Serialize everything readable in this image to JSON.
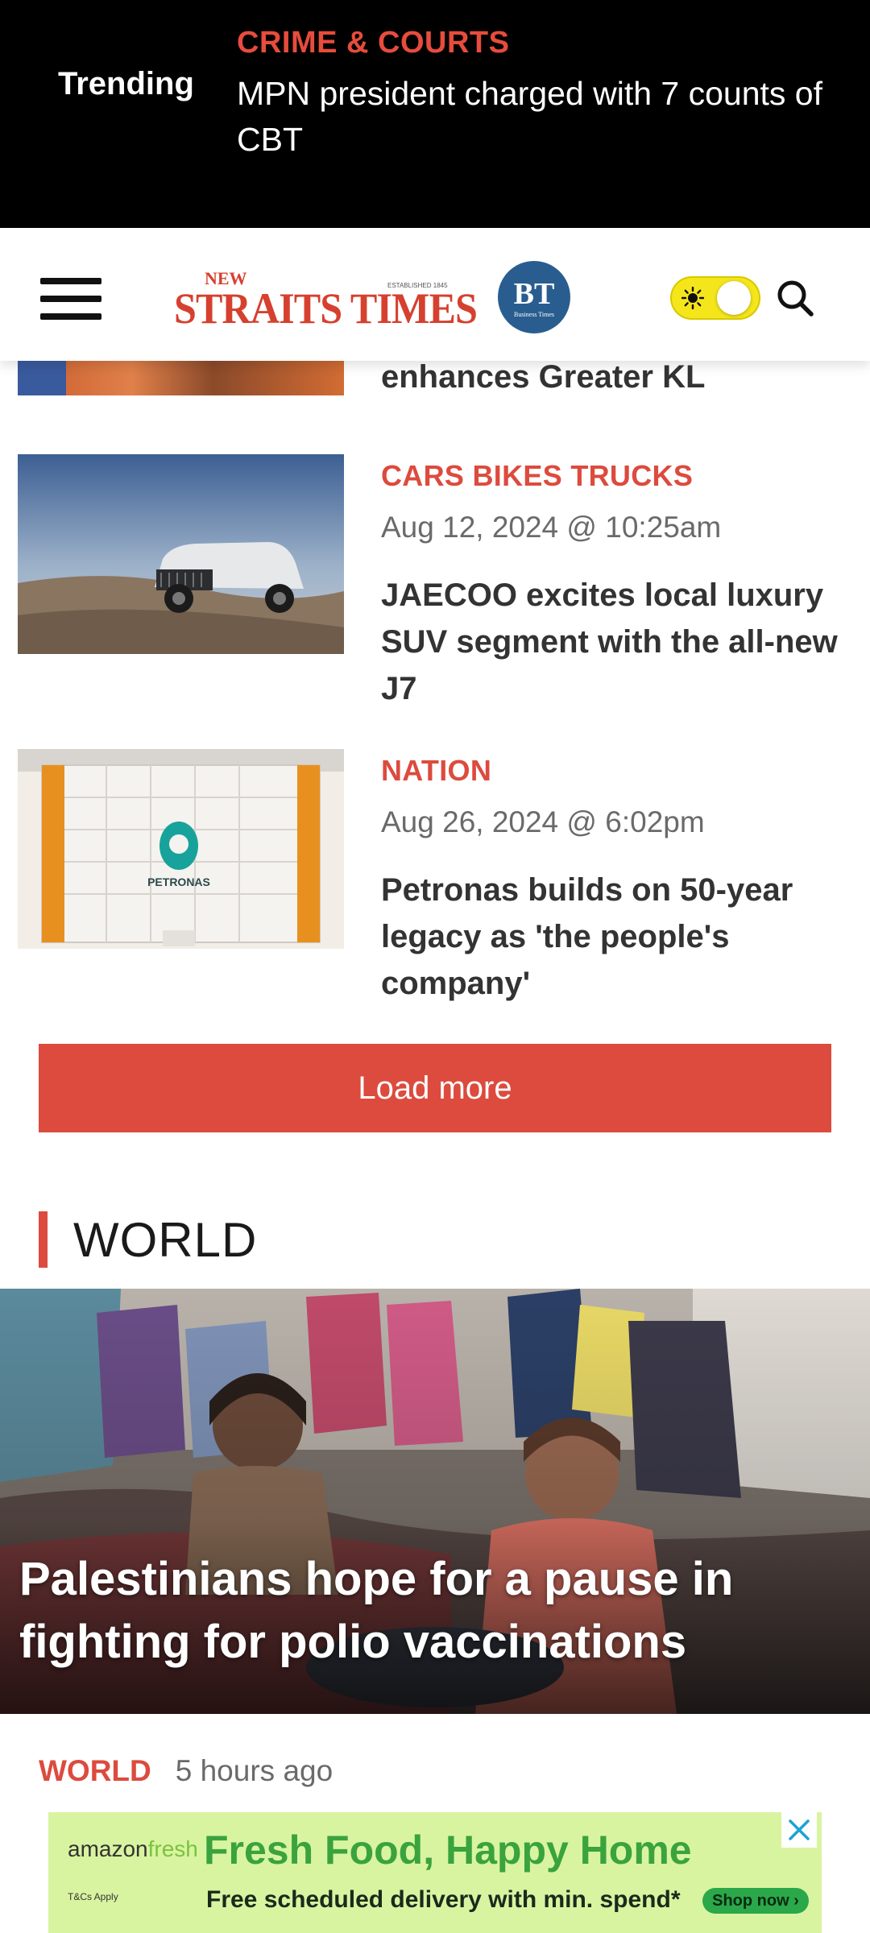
{
  "trending": {
    "label": "Trending",
    "category": "CRIME & COURTS",
    "headline": "MPN president charged with 7 counts of CBT"
  },
  "header": {
    "logo_text": "NEW STRAITS TIMES",
    "logo_est": "ESTABLISHED 1845",
    "bt_logo": "BT",
    "bt_sub": "Business Times",
    "icons": [
      "hamburger-icon",
      "sun-icon",
      "search-icon"
    ],
    "theme_mode": "light"
  },
  "partial_article": {
    "title": "enhances Greater KL"
  },
  "articles": [
    {
      "category": "CARS BIKES TRUCKS",
      "date": "Aug 12, 2024 @ 10:25am",
      "title": "JAECOO excites local luxury SUV segment with the all-new J7"
    },
    {
      "category": "NATION",
      "date": "Aug 26, 2024 @ 6:02pm",
      "title": "Petronas builds on 50-year legacy as 'the people's company'",
      "thumb_text": "PETRONAS"
    }
  ],
  "load_more_label": "Load more",
  "world_section": {
    "heading": "WORLD",
    "hero_title": "Palestinians hope for a pause in fighting for polio vaccinations",
    "category": "WORLD",
    "time": "5 hours ago"
  },
  "ad": {
    "brand_a": "amazon",
    "brand_b": "fresh",
    "headline": "Fresh Food, Happy Home",
    "subline": "Free scheduled delivery with min. spend*",
    "small_print": "T&Cs Apply",
    "cta": "Shop now ›",
    "close_icon": "close-icon"
  },
  "colors": {
    "accent": "#dc4b3e",
    "trending_bg": "#000000",
    "ad_bg": "#d9f4a0",
    "toggle": "#f5e61b"
  }
}
